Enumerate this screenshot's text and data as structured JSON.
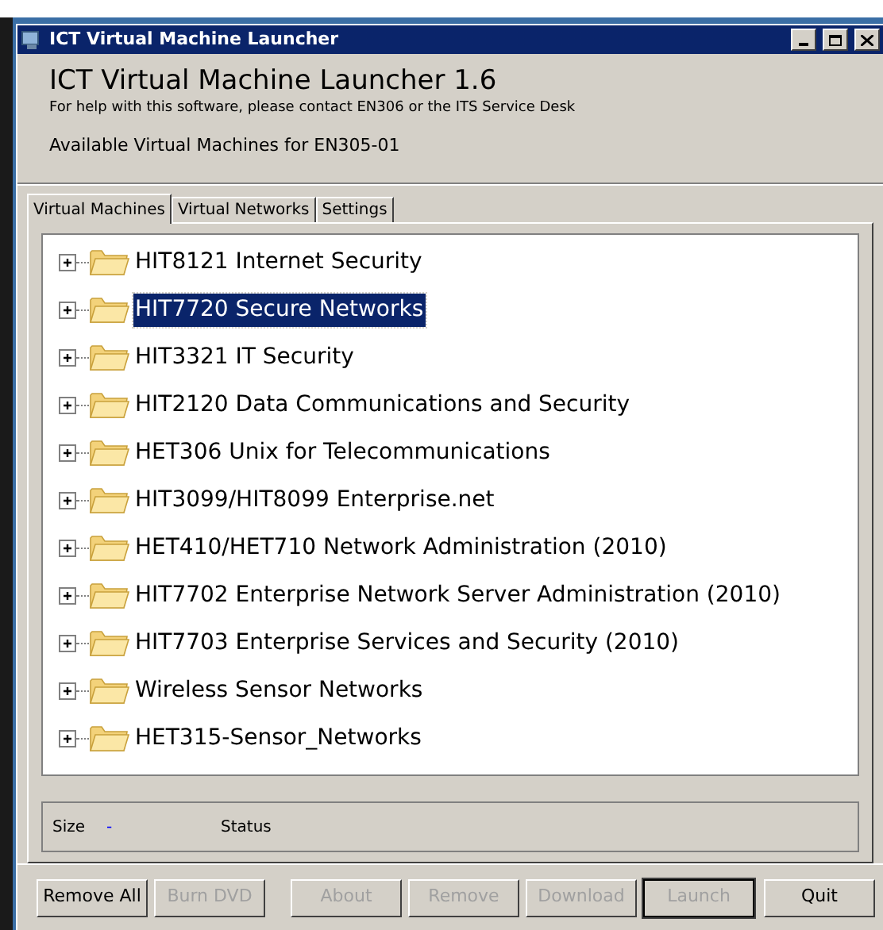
{
  "window": {
    "title": "ICT Virtual Machine Launcher"
  },
  "header": {
    "title": "ICT Virtual Machine Launcher 1.6",
    "help": "For help with this software, please contact EN306 or the ITS Service Desk",
    "subtitle": "Available Virtual Machines for EN305-01"
  },
  "tabs": [
    {
      "label": "Virtual Machines",
      "selected": true
    },
    {
      "label": "Virtual Networks",
      "selected": false
    },
    {
      "label": "Settings",
      "selected": false
    }
  ],
  "tree": [
    {
      "label": "HIT8121 Internet Security",
      "selected": false
    },
    {
      "label": "HIT7720 Secure Networks",
      "selected": true
    },
    {
      "label": "HIT3321 IT Security",
      "selected": false
    },
    {
      "label": "HIT2120 Data Communications and Security",
      "selected": false
    },
    {
      "label": "HET306 Unix for Telecommunications",
      "selected": false
    },
    {
      "label": "HIT3099/HIT8099 Enterprise.net",
      "selected": false
    },
    {
      "label": "HET410/HET710 Network Administration (2010)",
      "selected": false
    },
    {
      "label": "HIT7702 Enterprise Network Server Administration (2010)",
      "selected": false
    },
    {
      "label": "HIT7703 Enterprise Services and Security (2010)",
      "selected": false
    },
    {
      "label": "Wireless Sensor Networks",
      "selected": false
    },
    {
      "label": "HET315-Sensor_Networks",
      "selected": false
    }
  ],
  "status": {
    "size_label": "Size",
    "size_value": "-",
    "status_label": "Status"
  },
  "buttons": [
    {
      "label": "Remove All",
      "disabled": false,
      "default": false
    },
    {
      "label": "Burn DVD",
      "disabled": true,
      "default": false
    },
    {
      "label": "About",
      "disabled": true,
      "default": false
    },
    {
      "label": "Remove",
      "disabled": true,
      "default": false
    },
    {
      "label": "Download",
      "disabled": true,
      "default": false
    },
    {
      "label": "Launch",
      "disabled": true,
      "default": true
    },
    {
      "label": "Quit",
      "disabled": false,
      "default": false
    }
  ]
}
